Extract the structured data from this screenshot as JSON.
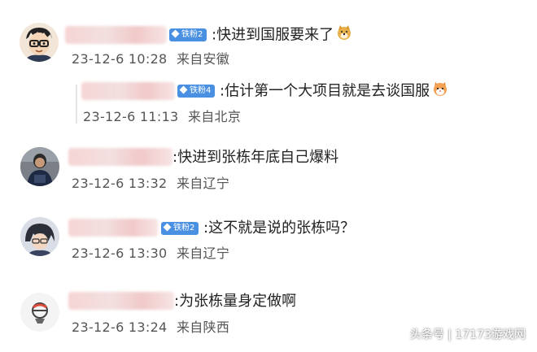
{
  "comments": [
    {
      "badge": "铁粉2",
      "text": ":快进到国服要来了",
      "time": "23-12-6 10:28",
      "location": "来自安徽",
      "emoji": "doge-emoji"
    },
    {
      "badge": "铁粉4",
      "text": ":估计第一个大项目就是去谈国服",
      "time": "23-12-6 11:13",
      "location": "来自北京",
      "emoji": "cat-emoji"
    },
    {
      "text": ":快进到张栋年底自己爆料",
      "time": "23-12-6 13:32",
      "location": "来自辽宁"
    },
    {
      "badge": "铁粉2",
      "text": ":这不就是说的张栋吗？",
      "time": "23-12-6 13:30",
      "location": "来自辽宁"
    },
    {
      "text": ":为张栋量身定做啊",
      "time": "23-12-6 13:24",
      "location": "来自陕西"
    }
  ],
  "watermark": "头条号 | 17173游戏网",
  "colors": {
    "badge": "#4a90e2",
    "meta_text": "#555555",
    "body_text": "#222222"
  }
}
